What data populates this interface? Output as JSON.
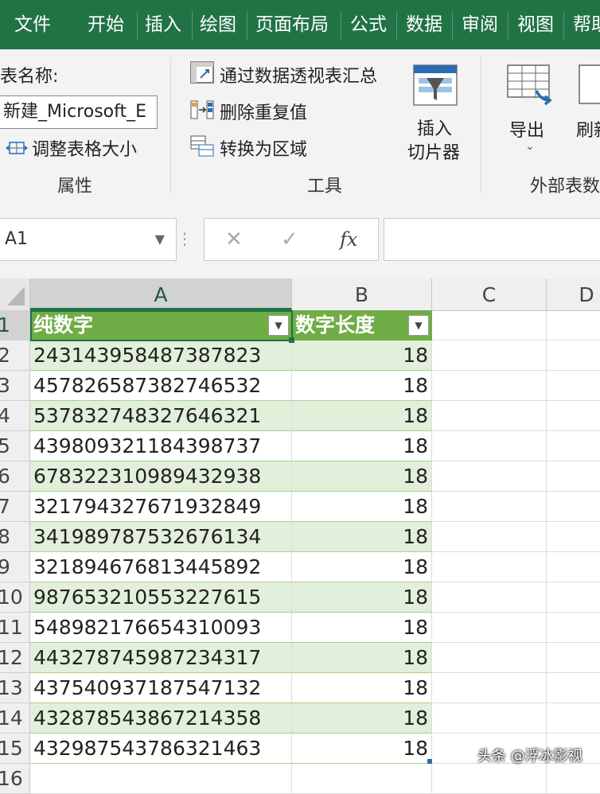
{
  "ribbon_tabs": [
    "文件",
    "开始",
    "插入",
    "绘图",
    "页面布局",
    "公式",
    "数据",
    "审阅",
    "视图",
    "帮助"
  ],
  "properties": {
    "table_name_label": "表名称:",
    "table_name_value": "新建_Microsoft_E",
    "resize_label": "调整表格大小",
    "group_label": "属性"
  },
  "tools": {
    "pivot_label": "通过数据透视表汇总",
    "remove_dup_label": "删除重复值",
    "convert_label": "转换为区域",
    "slicer_line1": "插入",
    "slicer_line2": "切片器",
    "group_label": "工具"
  },
  "external": {
    "export_label": "导出",
    "refresh_label": "刷新",
    "group_label": "外部表数据"
  },
  "formula_bar": {
    "name_box": "A1",
    "cancel_symbol": "✕",
    "enter_symbol": "✓",
    "fx_label": "fx",
    "formula": ""
  },
  "columns": [
    "A",
    "B",
    "C",
    "D"
  ],
  "table_headers": [
    "纯数字",
    "数字长度"
  ],
  "rows": [
    {
      "row": "1"
    },
    {
      "row": "2",
      "a": "243143958487387823",
      "b": "18"
    },
    {
      "row": "3",
      "a": "457826587382746532",
      "b": "18"
    },
    {
      "row": "4",
      "a": "537832748327646321",
      "b": "18"
    },
    {
      "row": "5",
      "a": "439809321184398737",
      "b": "18"
    },
    {
      "row": "6",
      "a": "678322310989432938",
      "b": "18"
    },
    {
      "row": "7",
      "a": "321794327671932849",
      "b": "18"
    },
    {
      "row": "8",
      "a": "341989787532676134",
      "b": "18"
    },
    {
      "row": "9",
      "a": "321894676813445892",
      "b": "18"
    },
    {
      "row": "10",
      "a": "987653210553227615",
      "b": "18"
    },
    {
      "row": "11",
      "a": "548982176654310093",
      "b": "18"
    },
    {
      "row": "12",
      "a": "443278745987234317",
      "b": "18"
    },
    {
      "row": "13",
      "a": "437540937187547132",
      "b": "18"
    },
    {
      "row": "14",
      "a": "432878543867214358",
      "b": "18"
    },
    {
      "row": "15",
      "a": "432987543786321463",
      "b": "18"
    },
    {
      "row": "16"
    }
  ],
  "watermark": "头条 @浮冰影视",
  "colors": {
    "accent": "#217346",
    "table_header": "#70ad47",
    "band": "#e2efda"
  }
}
